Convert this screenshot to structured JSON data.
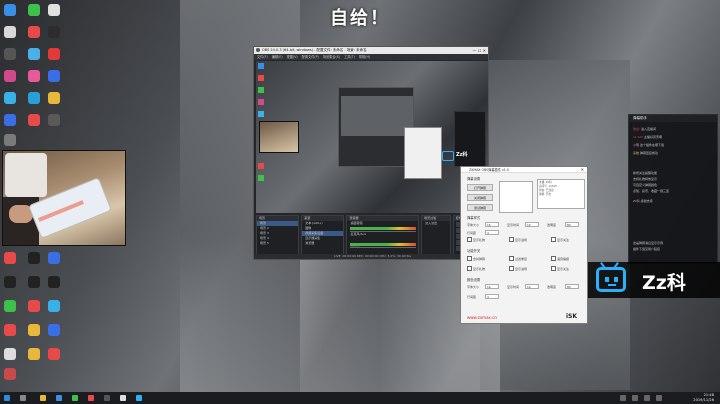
{
  "banner": {
    "text": "自给！"
  },
  "obs": {
    "title": "OBS 24.0.3 (64-bit, windows) - 配置文件: 未命名 - 场景: 未命名",
    "menu": [
      "文件(F)",
      "编辑(E)",
      "视图(V)",
      "配置文件(P)",
      "场景集合(S)",
      "工具(T)",
      "帮助(H)"
    ],
    "docks": {
      "scenes": {
        "title": "场景",
        "items": [
          "场景",
          "场景 2",
          "场景 3",
          "场景 4",
          "场景 5"
        ]
      },
      "sources": {
        "title": "来源",
        "items": [
          "文本 (GDI+)",
          "图像",
          "视频采集设备",
          "显示器采集",
          "浏览器"
        ]
      },
      "mixer": {
        "title": "混音器",
        "channels": [
          "桌面音频",
          "麦克风/Aux",
          "媒体源"
        ]
      },
      "transitions": {
        "title": "场景过渡",
        "value": "淡入淡出"
      },
      "controls": {
        "title": "控件",
        "buttons": [
          "开始推流",
          "开始录制",
          "工作室模式",
          "设置",
          "退出"
        ]
      }
    },
    "status": "LIVE: 00:00:00   REC: 00:00:00   CPU: 3.2%, 30.00 fps"
  },
  "tool": {
    "title": "ZXMAX OBS弹幕插件 v1.0",
    "section1": "弹幕设置",
    "btn_open": "打开弹幕",
    "btn_close": "关闭弹幕",
    "btn_test": "测试弹幕",
    "list_text": [
      "主播: Zz科",
      "房间号: 12345",
      "状态: 已连接",
      "弹幕: 开启"
    ],
    "section2": "弹幕样式",
    "labels": [
      "字体大小",
      "显示时间",
      "透明度",
      "行间距"
    ],
    "values": [
      "16",
      "10",
      "80",
      "4"
    ],
    "checks": [
      "显示礼物",
      "显示进场",
      "显示关注",
      "合并弹幕",
      "过滤重复",
      "语音播报"
    ],
    "section3": "功能开关",
    "section4": "颜色设置",
    "link": "www.zxmax.cn",
    "brand": "iSK"
  },
  "chat": {
    "title": "弹幕助手",
    "lines": [
      {
        "user": "欢迎:",
        "msg": "进入直播间"
      },
      {
        "user": "zz-123",
        "msg": "主播好厉害啊"
      },
      {
        "user": "小明",
        "msg": "这个插件在哪下载"
      },
      {
        "user": "系统",
        "msg": "弹幕连接成功"
      },
      {
        "user": "",
        "msg": "新增关注提醒功能"
      },
      {
        "user": "",
        "msg": "支持礼物特效显示"
      },
      {
        "user": "",
        "msg": "可自定义弹幕颜色"
      },
      {
        "user": "",
        "msg": "点赞、投币、收藏一键三连"
      },
      {
        "user": "Zz科",
        "msg": "感谢支持"
      },
      {
        "user": "",
        "msg": "这是弹幕消息显示示例"
      },
      {
        "user": "",
        "msg": "插件下载见简介链接"
      }
    ]
  },
  "logo": {
    "text": "Zz科",
    "accent": "#2ab0ff"
  },
  "taskbar": {
    "time": "21:48",
    "date": "2019/11/26"
  }
}
